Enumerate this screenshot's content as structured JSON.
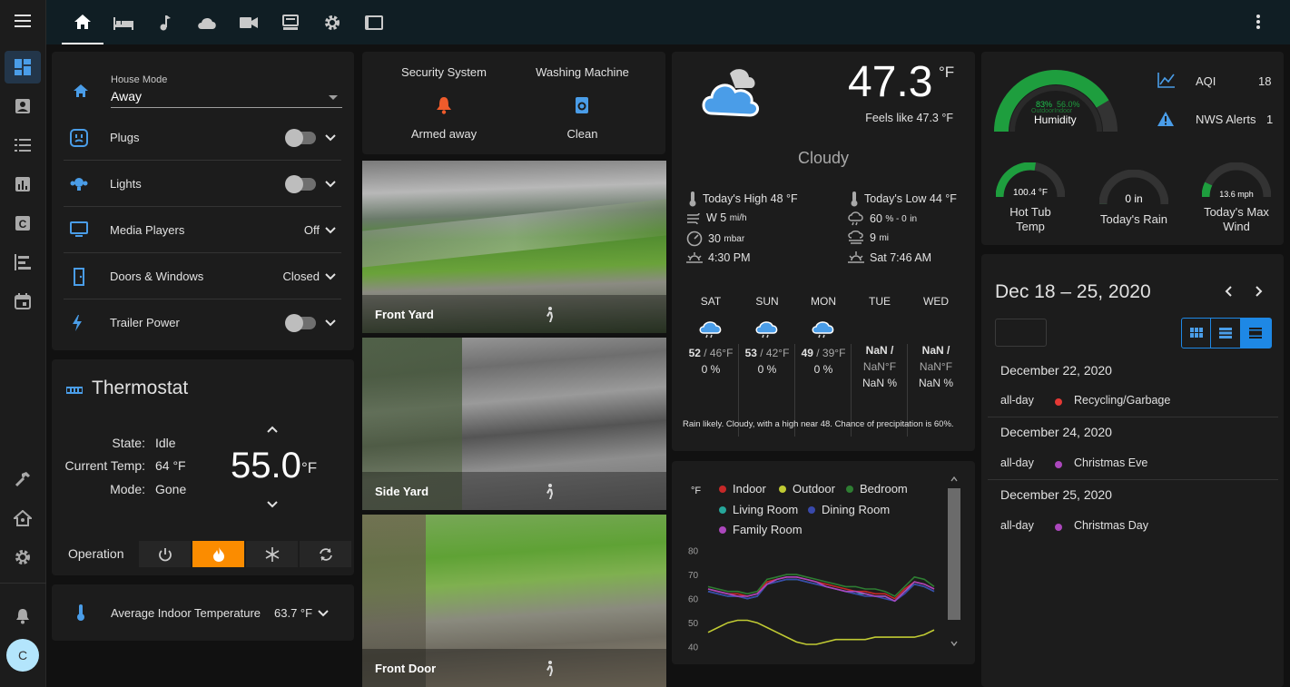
{
  "sidebar": {
    "avatar_letter": "C"
  },
  "house_mode": {
    "label": "House Mode",
    "value": "Away"
  },
  "entities": [
    {
      "name": "Plugs",
      "state": ""
    },
    {
      "name": "Lights",
      "state": ""
    },
    {
      "name": "Media Players",
      "state": "Off"
    },
    {
      "name": "Doors & Windows",
      "state": "Closed"
    },
    {
      "name": "Trailer Power",
      "state": ""
    }
  ],
  "thermostat": {
    "title": "Thermostat",
    "state_label": "State:",
    "state": "Idle",
    "current_label": "Current Temp:",
    "current": "64 °F",
    "mode_label": "Mode:",
    "mode": "Gone",
    "setpoint": "55.0",
    "unit": "°F",
    "operation_label": "Operation"
  },
  "avg_temp": {
    "label": "Average Indoor Temperature",
    "value": "63.7 °F"
  },
  "glance": [
    {
      "name": "Security System",
      "state": "Armed away"
    },
    {
      "name": "Washing Machine",
      "state": "Clean"
    }
  ],
  "cameras": [
    {
      "name": "Front Yard"
    },
    {
      "name": "Side Yard"
    },
    {
      "name": "Front Door"
    }
  ],
  "weather": {
    "temp": "47.3",
    "unit": "°F",
    "feels_like": "Feels like 47.3 °F",
    "condition": "Cloudy",
    "high": "Today's High 48 °F",
    "low": "Today's Low 44 °F",
    "wind": "W 5",
    "wind_unit": "mi/h",
    "precip": "60",
    "precip_unit": "% - 0",
    "precip_unit2": "in",
    "pressure": "30",
    "pressure_unit": "mbar",
    "visibility": "9",
    "visibility_unit": "mi",
    "sunset": "4:30 PM",
    "sunrise": "Sat 7:46 AM",
    "forecast": [
      {
        "day": "SAT",
        "high": "52",
        "low": "/ 46°F",
        "precip": "0 %"
      },
      {
        "day": "SUN",
        "high": "53",
        "low": "/ 42°F",
        "precip": "0 %"
      },
      {
        "day": "MON",
        "high": "49",
        "low": "/ 39°F",
        "precip": "0 %"
      },
      {
        "day": "TUE",
        "high": "NaN /",
        "low": "NaN°F",
        "precip": "NaN %"
      },
      {
        "day": "WED",
        "high": "NaN /",
        "low": "NaN°F",
        "precip": "NaN %"
      }
    ],
    "summary": "Rain likely. Cloudy, with a high near 48. Chance of precipitation is 60%."
  },
  "gauges": {
    "humidity": {
      "label": "Humidity",
      "outdoor": "83%",
      "indoor": "56.0%",
      "sub": "OutdoorIndoor",
      "outdoor_value": 83,
      "indoor_value": 56
    },
    "aqi": {
      "label": "AQI",
      "value": "18"
    },
    "nws": {
      "label": "NWS Alerts",
      "value": "1"
    },
    "hottub": {
      "label1": "Hot Tub",
      "label2": "Temp",
      "value": "100.4 °F",
      "fraction": 0.55
    },
    "rain": {
      "label": "Today's Rain",
      "value": "0 in",
      "fraction": 0
    },
    "wind": {
      "label1": "Today's Max",
      "label2": "Wind",
      "value": "13.6 mph",
      "fraction": 0.14
    }
  },
  "calendar": {
    "range": "Dec 18 – 25, 2020",
    "events": [
      {
        "date": "December 22, 2020",
        "time": "all-day",
        "title": "Recycling/Garbage",
        "color": "#e53935"
      },
      {
        "date": "December 24, 2020",
        "time": "all-day",
        "title": "Christmas Eve",
        "color": "#ab47bc"
      },
      {
        "date": "December 25, 2020",
        "time": "all-day",
        "title": "Christmas Day",
        "color": "#ab47bc"
      }
    ]
  },
  "chart_data": {
    "type": "line",
    "ylabel": "°F",
    "yticks": [
      "80",
      "70",
      "60",
      "50",
      "40"
    ],
    "ylim": [
      38,
      84
    ],
    "series": [
      {
        "name": "Indoor",
        "color": "#c62828",
        "values": [
          64,
          63,
          62,
          62,
          61,
          62,
          67,
          68,
          69,
          69,
          68,
          67,
          66,
          65,
          64,
          63,
          63,
          62,
          62,
          60,
          64,
          67,
          66,
          64
        ]
      },
      {
        "name": "Outdoor",
        "color": "#c0ca33",
        "values": [
          46,
          48,
          50,
          51,
          51,
          50,
          48,
          46,
          44,
          42,
          41,
          41,
          42,
          43,
          43,
          43,
          43,
          44,
          44,
          44,
          44,
          44,
          45,
          47
        ]
      },
      {
        "name": "Bedroom",
        "color": "#2e7d32",
        "values": [
          65,
          64,
          63,
          63,
          62,
          63,
          68,
          69,
          70,
          70,
          69,
          68,
          67,
          66,
          65,
          65,
          64,
          64,
          63,
          61,
          65,
          69,
          68,
          65
        ]
      },
      {
        "name": "Living Room",
        "color": "#26a69a",
        "values": [
          63,
          62,
          61,
          61,
          60,
          61,
          66,
          67,
          68,
          68,
          67,
          66,
          65,
          64,
          63,
          62,
          62,
          61,
          61,
          59,
          63,
          66,
          65,
          63
        ]
      },
      {
        "name": "Dining Room",
        "color": "#3949ab",
        "values": [
          63,
          62,
          61,
          61,
          60,
          61,
          66,
          67,
          68,
          68,
          67,
          66,
          65,
          64,
          63,
          62,
          61,
          61,
          60,
          59,
          62,
          66,
          65,
          63
        ]
      },
      {
        "name": "Family Room",
        "color": "#ab47bc",
        "values": [
          64,
          63,
          62,
          61,
          61,
          62,
          66,
          68,
          69,
          69,
          68,
          67,
          65,
          64,
          63,
          63,
          62,
          61,
          61,
          59,
          63,
          67,
          66,
          64
        ]
      }
    ]
  }
}
